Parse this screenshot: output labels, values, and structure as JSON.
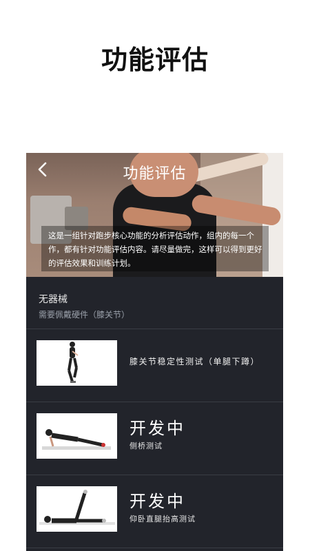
{
  "promo": {
    "title": "功能评估"
  },
  "nav": {
    "back_icon": "chevron-left-icon",
    "title": "功能评估"
  },
  "intro": {
    "text": "这是一组针对跑步核心功能的分析评估动作，组内的每一个作，都有针对功能评估内容。请尽量做完，这样可以得到更好的评估效果和训练计划。"
  },
  "section": {
    "name": "无器械",
    "subtitle": "需要佩戴硬件（膝关节）"
  },
  "items": [
    {
      "title": "膝关节稳定性测试（单腿下蹲）",
      "status": ""
    },
    {
      "title": "侧桥测试",
      "status": "开发中"
    },
    {
      "title": "仰卧直腿抬高测试",
      "status": "开发中"
    }
  ],
  "colors": {
    "panel": "#22242b",
    "divider": "#3a3d45",
    "text": "#ffffff"
  }
}
